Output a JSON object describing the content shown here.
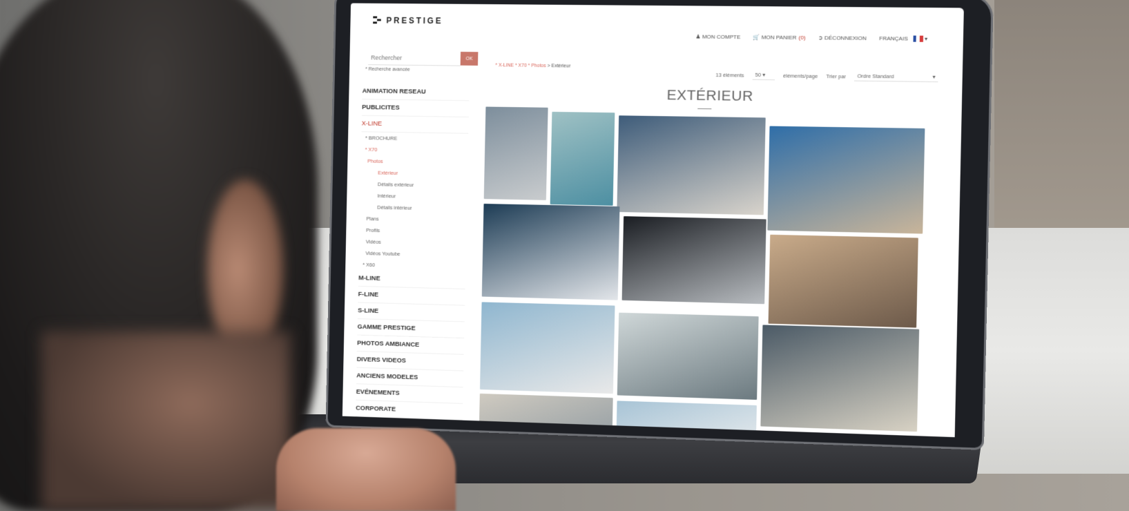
{
  "brand": {
    "name": "PRESTIGE"
  },
  "topnav": {
    "account": "MON COMPTE",
    "cart": "MON PANIER",
    "cart_count": "(0)",
    "logout": "DÉCONNEXION",
    "language": "FRANÇAIS"
  },
  "search": {
    "placeholder": "Rechercher",
    "button": "OK",
    "advanced": "* Recherche avancée"
  },
  "sidebar": {
    "items": [
      {
        "label": "ANIMATION RESEAU",
        "type": "cat"
      },
      {
        "label": "PUBLICITES",
        "type": "cat"
      },
      {
        "label": "X-LINE",
        "type": "cat-active"
      },
      {
        "label": "* BROCHURE",
        "type": "sub"
      },
      {
        "label": "* X70",
        "type": "sub-red"
      },
      {
        "label": "Photos",
        "type": "l2-red"
      },
      {
        "label": "Extérieur",
        "type": "l3-red"
      },
      {
        "label": "Détails extérieur",
        "type": "l3"
      },
      {
        "label": "Intérieur",
        "type": "l3"
      },
      {
        "label": "Détails intérieur",
        "type": "l3"
      },
      {
        "label": "Plans",
        "type": "l2"
      },
      {
        "label": "Profils",
        "type": "l2"
      },
      {
        "label": "Vidéos",
        "type": "l2"
      },
      {
        "label": "Vidéos Youtube",
        "type": "l2"
      },
      {
        "label": "* X60",
        "type": "sub"
      },
      {
        "label": "M-LINE",
        "type": "cat"
      },
      {
        "label": "F-LINE",
        "type": "cat"
      },
      {
        "label": "S-LINE",
        "type": "cat"
      },
      {
        "label": "GAMME PRESTIGE",
        "type": "cat"
      },
      {
        "label": "PHOTOS AMBIANCE",
        "type": "cat"
      },
      {
        "label": "DIVERS VIDEOS",
        "type": "cat"
      },
      {
        "label": "ANCIENS MODELES",
        "type": "cat"
      },
      {
        "label": "EVÉNEMENTS",
        "type": "cat"
      },
      {
        "label": "CORPORATE",
        "type": "cat"
      }
    ]
  },
  "breadcrumb": [
    "* X-LINE",
    "* X70",
    "* Photos",
    "> Extérieur"
  ],
  "toolbar": {
    "count": "13 éléments",
    "per_page_value": "50",
    "per_page_label": "éléments/page",
    "sort_label": "Trier par",
    "sort_value": "Ordre Standard"
  },
  "page": {
    "title": "EXTÉRIEUR"
  },
  "gallery": {
    "photos": [
      {
        "name": "flybridge-guests",
        "colors": [
          "#7d8e9c",
          "#c9ccce"
        ]
      },
      {
        "name": "yacht-at-anchor",
        "colors": [
          "#9fc1c4",
          "#4d8fa2"
        ]
      },
      {
        "name": "cushion-sea-detail",
        "colors": [
          "#3e5c7a",
          "#d9d4cc"
        ]
      },
      {
        "name": "bow-sunbathing",
        "colors": [
          "#2f6ea8",
          "#c9b59a"
        ]
      },
      {
        "name": "aerial-view",
        "colors": [
          "#1d3c55",
          "#e3e6ea"
        ]
      },
      {
        "name": "cockpit-couple",
        "colors": [
          "#1a1d22",
          "#b8bcc0"
        ]
      },
      {
        "name": "teak-detail",
        "colors": [
          "#c9ab8a",
          "#6d5a4a"
        ]
      },
      {
        "name": "stern-swim-platform",
        "colors": [
          "#8fb6cf",
          "#e9e9e9"
        ]
      },
      {
        "name": "yacht-underway",
        "colors": [
          "#cfd7d8",
          "#6c7a80"
        ]
      },
      {
        "name": "x70-hull-logo",
        "colors": [
          "#4b5a66",
          "#d8d2c4"
        ]
      },
      {
        "name": "row4-a",
        "colors": [
          "#cfcac0",
          "#9aa2a6"
        ]
      },
      {
        "name": "row4-b",
        "colors": [
          "#a8c4d6",
          "#dfe6ea"
        ]
      },
      {
        "name": "row4-c",
        "colors": [
          "#d8d0c2",
          "#b4a894"
        ]
      }
    ]
  },
  "colors": {
    "accent": "#c8776a",
    "active_link": "#c0392b"
  }
}
